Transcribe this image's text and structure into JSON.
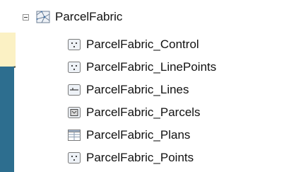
{
  "tree": {
    "root": {
      "label": "ParcelFabric",
      "icon": "parcel-fabric-dataset-icon",
      "expanded": true
    },
    "children": [
      {
        "label": "ParcelFabric_Control",
        "icon": "point-feature-class-icon"
      },
      {
        "label": "ParcelFabric_LinePoints",
        "icon": "point-feature-class-icon"
      },
      {
        "label": "ParcelFabric_Lines",
        "icon": "line-feature-class-icon"
      },
      {
        "label": "ParcelFabric_Parcels",
        "icon": "polygon-feature-class-icon"
      },
      {
        "label": "ParcelFabric_Plans",
        "icon": "table-icon"
      },
      {
        "label": "ParcelFabric_Points",
        "icon": "point-feature-class-icon"
      }
    ]
  },
  "colors": {
    "background": "#ffffff",
    "text": "#111111",
    "icon_border": "#7a7a7a",
    "icon_fill": "#eef2f7",
    "map_blue": "#2d6e8f",
    "map_yellow": "#fbf1c4"
  }
}
